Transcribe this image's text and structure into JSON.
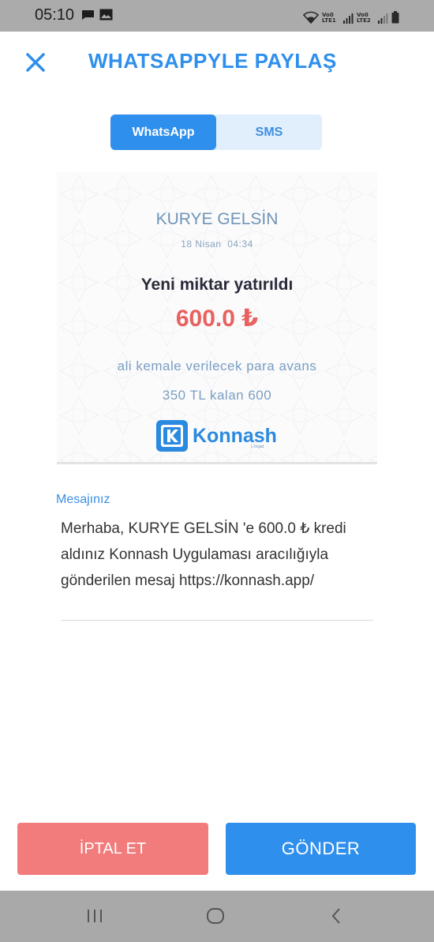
{
  "status_bar": {
    "time": "05:10",
    "icons": [
      "message-icon",
      "image-icon",
      "wifi-icon",
      "signal-icon",
      "signal-icon",
      "battery-icon"
    ],
    "network_labels": [
      "Vo0 LTE1",
      "Vo0 LTE2"
    ]
  },
  "header": {
    "title": "WHATSAPPYLE PAYLAŞ",
    "close_icon": "close-icon"
  },
  "tabs": [
    {
      "label": "WhatsApp",
      "active": true
    },
    {
      "label": "SMS",
      "active": false
    }
  ],
  "preview": {
    "business_name": "KURYE GELSİN",
    "date": "18 Nisan  04:34",
    "headline": "Yeni miktar yatırıldı",
    "amount": "600.0 ₺",
    "description": "ali kemale verilecek para avans",
    "note": "350 TL kalan 600",
    "brand": {
      "name": "Konnash",
      "sub": "L İnçad"
    }
  },
  "message": {
    "label": "Mesajınız",
    "text": "Merhaba, KURYE GELSİN 'e 600.0 ₺ kredi aldınız Konnash Uygulaması aracılığıyla gönderilen mesaj https://konnash.app/"
  },
  "buttons": {
    "cancel": "İPTAL ET",
    "send": "GÖNDER"
  },
  "nav": [
    "recent-apps-icon",
    "home-icon",
    "back-icon"
  ],
  "colors": {
    "primary": "#2f8fec",
    "cancel": "#f27b7b",
    "amount": "#e8615f",
    "tab_bg": "#e1eefb",
    "status_bar": "#ababab"
  }
}
